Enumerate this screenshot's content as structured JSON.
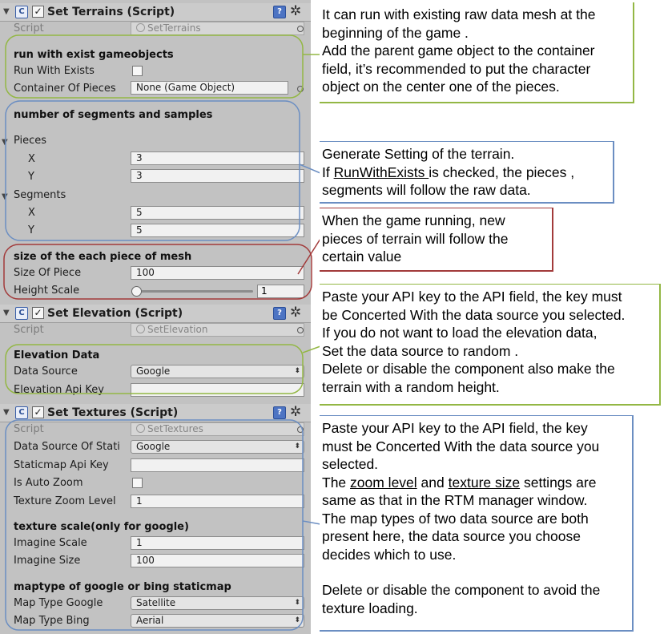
{
  "colors": {
    "green": "#93b744",
    "blue": "#6b8ec2",
    "red": "#a23a3a",
    "panel": "#c2c2c2"
  },
  "terrains": {
    "title": "Set Terrains (Script)",
    "script_label": "Script",
    "script_value": "SetTerrains",
    "section_run": "run with exist gameobjects",
    "run_with_exists_label": "Run With Exists",
    "container_label": "Container Of Pieces",
    "container_value": "None (Game Object)",
    "section_segments": "number of segments and samples",
    "pieces_label": "Pieces",
    "pieces_x_label": "X",
    "pieces_x_value": "3",
    "pieces_y_label": "Y",
    "pieces_y_value": "3",
    "segments_label": "Segments",
    "segments_x_label": "X",
    "segments_x_value": "5",
    "segments_y_label": "Y",
    "segments_y_value": "5",
    "section_size": "size of the each piece of mesh",
    "size_label": "Size Of Piece",
    "size_value": "100",
    "height_label": "Height Scale",
    "height_value": "1"
  },
  "elevation": {
    "title": "Set Elevation (Script)",
    "script_label": "Script",
    "script_value": "SetElevation",
    "section": "Elevation Data",
    "data_source_label": "Data Source",
    "data_source_value": "Google",
    "api_key_label": "Elevation Api Key"
  },
  "textures": {
    "title": "Set Textures (Script)",
    "script_label": "Script",
    "script_value": "SetTextures",
    "data_source_label": "Data Source Of Stati",
    "data_source_value": "Google",
    "staticmap_key_label": "Staticmap Api Key",
    "auto_zoom_label": "Is Auto Zoom",
    "zoom_level_label": "Texture Zoom Level",
    "zoom_level_value": "1",
    "section_scale": "texture scale(only for google)",
    "imagine_scale_label": "Imagine Scale",
    "imagine_scale_value": "1",
    "imagine_size_label": "Imagine Size",
    "imagine_size_value": "100",
    "section_maptype": "maptype of google or bing staticmap",
    "map_google_label": "Map Type Google",
    "map_google_value": "Satellite",
    "map_bing_label": "Map Type Bing",
    "map_bing_value": "Aerial"
  },
  "notes": {
    "n1": [
      "It can run with existing raw data mesh at the",
      "beginning of the game .",
      "Add the parent game object to the container",
      "field, it’s recommended to put the character",
      "object on the center one of the pieces."
    ],
    "n2_l1": "Generate Setting of the terrain.",
    "n2_l2_pre": "If ",
    "n2_l2_u": "RunWithExists ",
    "n2_l2_post": "is checked, the pieces ,",
    "n2_l3": "segments will follow the raw data.",
    "n3": [
      "When the game running, new",
      "pieces of terrain will follow the",
      "certain value"
    ],
    "n4": [
      "Paste your API key to the API field, the key must",
      "be Concerted With the data source you selected.",
      "If you do not want to load the elevation data,",
      "Set the data source to random .",
      "Delete or disable the component also make the",
      "terrain with a random height."
    ],
    "n5_l1": "Paste your API key to the API field, the key",
    "n5_l2": "must be Concerted With the data source you",
    "n5_l3": "selected.",
    "n5_l4_pre": "The ",
    "n5_l4_u1": "zoom level",
    "n5_l4_mid": " and ",
    "n5_l4_u2": "texture size",
    "n5_l4_post": " settings are",
    "n5_l5": "same as that in the RTM manager window.",
    "n5_l6": "The map types of two data source are both",
    "n5_l7": "present here, the data source you choose",
    "n5_l8": "decides which to use.",
    "n5_l9": "Delete or disable the component to avoid the",
    "n5_l10": "texture loading."
  }
}
